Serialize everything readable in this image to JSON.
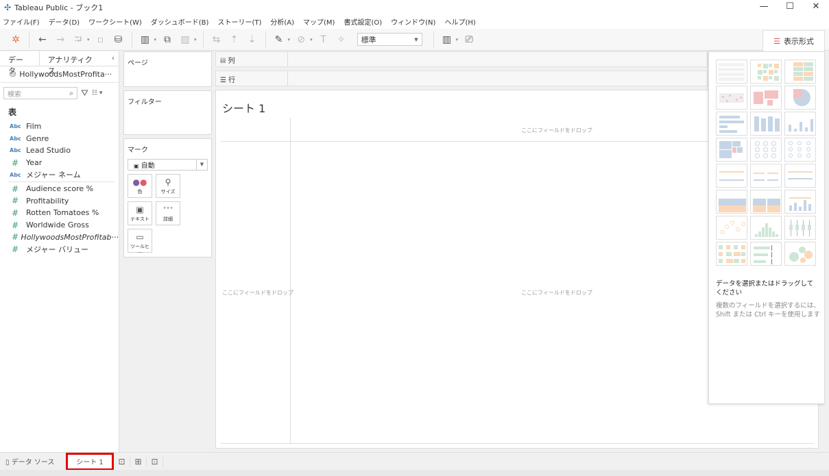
{
  "window": {
    "title": "Tableau Public - ブック1",
    "minimize": "—",
    "maximize": "☐",
    "close": "✕"
  },
  "menu": [
    "ファイル(F)",
    "データ(D)",
    "ワークシート(W)",
    "ダッシュボード(B)",
    "ストーリー(T)",
    "分析(A)",
    "マップ(M)",
    "書式設定(O)",
    "ウィンドウ(N)",
    "ヘルプ(H)"
  ],
  "toolbar": {
    "fit_value": "標準"
  },
  "left_panel": {
    "tabs": [
      "データ",
      "アナリティクス"
    ],
    "datasource": "HollywoodsMostProfita···",
    "search_placeholder": "検索",
    "section": "表",
    "dimensions": [
      {
        "type": "Abc",
        "name": "Film"
      },
      {
        "type": "Abc",
        "name": "Genre"
      },
      {
        "type": "Abc",
        "name": "Lead Studio"
      },
      {
        "type": "#",
        "name": "Year"
      },
      {
        "type": "Abc",
        "name": "メジャー ネーム"
      }
    ],
    "measures": [
      {
        "type": "#",
        "name": "Audience  score %"
      },
      {
        "type": "#",
        "name": "Profitability"
      },
      {
        "type": "#",
        "name": "Rotten Tomatoes %"
      },
      {
        "type": "#",
        "name": "Worldwide Gross"
      },
      {
        "type": "#",
        "name": "HollywoodsMostProfitab···",
        "italic": true
      },
      {
        "type": "#",
        "name": "メジャー バリュー"
      }
    ]
  },
  "cards": {
    "pages": "ページ",
    "filters": "フィルター",
    "marks": "マーク",
    "mark_type": "自動",
    "mark_buttons": [
      "色",
      "サイズ",
      "テキスト",
      "詳細",
      "ツールヒ···"
    ]
  },
  "shelves": {
    "columns": "列",
    "rows": "行"
  },
  "sheet": {
    "title": "シート 1",
    "drop_top": "ここにフィールドをドロップ",
    "drop_left": "ここにフィールドをドロップ",
    "drop_center": "ここにフィールドをドロップ"
  },
  "show_me": {
    "tab_label": "表示形式",
    "charts": [
      "text-table",
      "heat-map",
      "highlight-table",
      "symbol-map",
      "filled-map",
      "pie-chart",
      "horizontal-bars",
      "stacked-bars",
      "side-by-side-bars",
      "treemap",
      "circle-view",
      "side-by-side-circles",
      "continuous-lines",
      "discrete-lines",
      "dual-lines",
      "area-continuous",
      "area-discrete",
      "dual-combination",
      "scatter-plot",
      "histogram",
      "box-whisker",
      "gantt-chart",
      "bullet-graph",
      "packed-bubbles"
    ],
    "hint_title": "データを選択またはドラッグしてください",
    "hint_body": "複数のフィールドを選択するには、Shift または Ctrl キーを使用します"
  },
  "bottom": {
    "datasource_tab": "データ ソース",
    "sheet_tab": "シート 1"
  },
  "colors": {
    "highlight": "#e30000",
    "blue": "#c5d5e6",
    "orange": "#fbd8b8",
    "green": "#cfe6d7",
    "red": "#f3c1c1"
  }
}
